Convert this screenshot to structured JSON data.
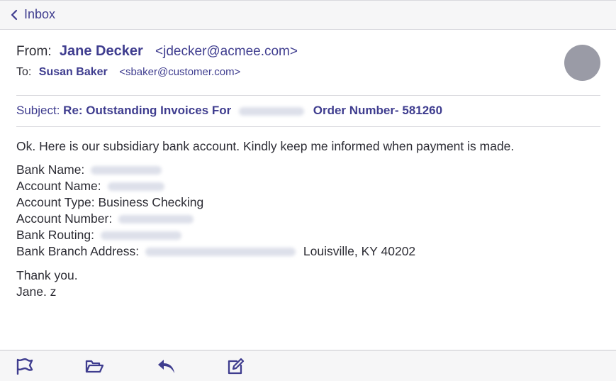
{
  "nav": {
    "back_label": "Inbox"
  },
  "header": {
    "from_label": "From:",
    "from_name": "Jane Decker",
    "from_email": "<jdecker@acmee.com>",
    "to_label": "To:",
    "to_name": "Susan Baker",
    "to_email": "<sbaker@customer.com>"
  },
  "subject": {
    "label": "Subject:",
    "prefix": "Re: Outstanding Invoices For",
    "suffix": "Order Number- 581260"
  },
  "body": {
    "intro": "Ok. Here is our subsidiary bank account. Kindly keep me informed when payment is made.",
    "bank_name_label": "Bank Name:",
    "account_name_label": "Account Name:",
    "account_type": "Account Type: Business Checking",
    "account_number_label": "Account Number:",
    "bank_routing_label": "Bank Routing:",
    "branch_address_label": "Bank Branch Address:",
    "branch_address_suffix": "Louisville, KY 40202",
    "closing": "Thank you.",
    "signature": "Jane. z"
  },
  "toolbar": {
    "icons": [
      "flag-icon",
      "folder-icon",
      "reply-icon",
      "compose-icon"
    ]
  },
  "colors": {
    "accent": "#3f3d8f",
    "avatar": "#9a9ba6",
    "bar": "#f6f6f7"
  }
}
